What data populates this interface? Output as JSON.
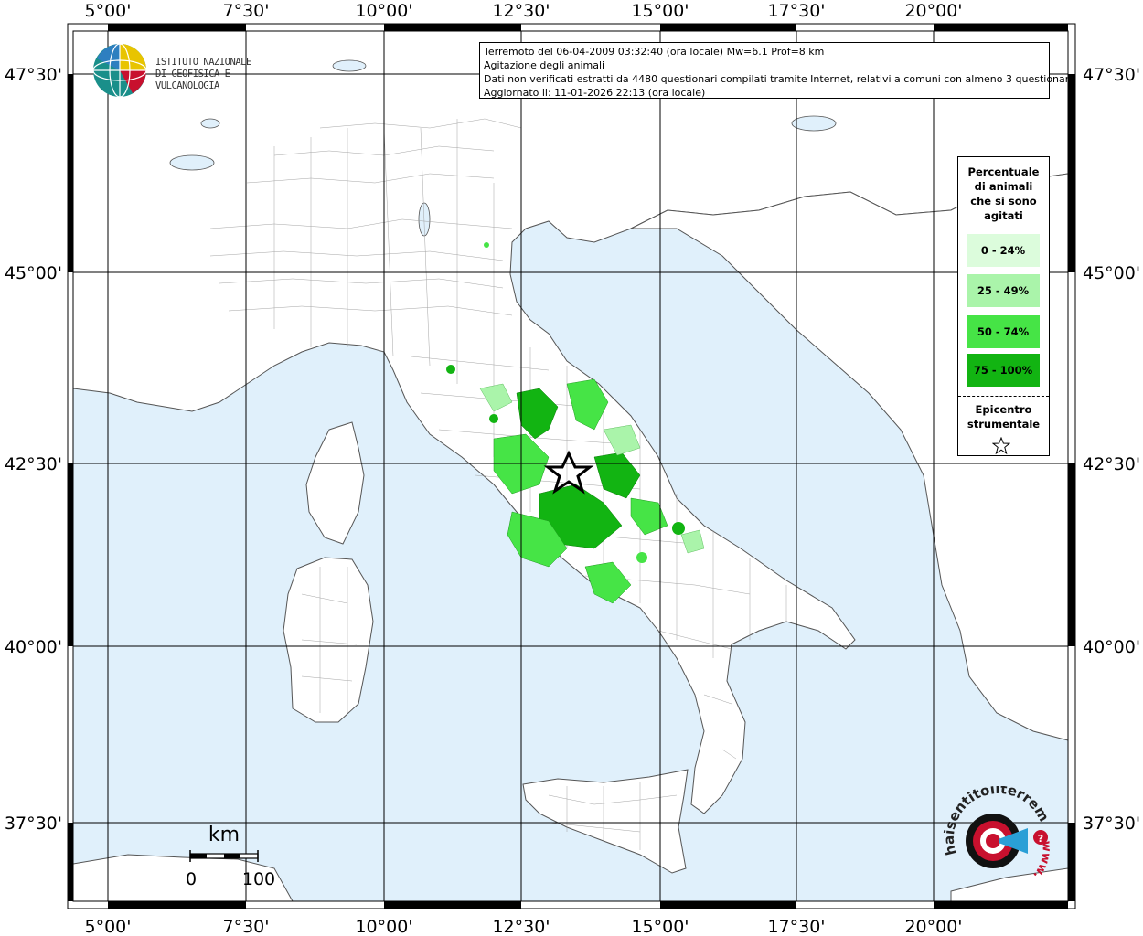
{
  "info": {
    "line1": "Terremoto del 06-04-2009 03:32:40 (ora locale) Mw=6.1 Prof=8 km",
    "line2": "Agitazione degli animali",
    "line3": "Dati non verificati estratti da 4480 questionari compilati tramite Internet, relativi a comuni con almeno 3 questionari.",
    "line4": "Aggiornato il: 11-01-2026 22:13 (ora locale)"
  },
  "logo": {
    "line1": "ISTITUTO NAZIONALE",
    "line2": "DI GEOFISICA E VULCANOLOGIA"
  },
  "axes": {
    "lon_labels": [
      "5°00'",
      "7°30'",
      "10°00'",
      "12°30'",
      "15°00'",
      "17°30'",
      "20°00'"
    ],
    "lat_labels": [
      "47°30'",
      "45°00'",
      "42°30'",
      "40°00'",
      "37°30'"
    ]
  },
  "legend": {
    "title_lines": [
      "Percentuale",
      "di animali",
      "che si sono",
      "agitati"
    ],
    "classes": [
      {
        "label": "0 - 24%",
        "color": "#dcfcdc"
      },
      {
        "label": "25 - 49%",
        "color": "#aaf4aa"
      },
      {
        "label": "50 - 74%",
        "color": "#46e446"
      },
      {
        "label": "75 - 100%",
        "color": "#12b412"
      }
    ],
    "epicenter_lines": [
      "Epicentro",
      "strumentale"
    ]
  },
  "scale": {
    "unit": "km",
    "start": "0",
    "end": "100"
  },
  "brand": {
    "text": "haisentitoilterremoto.it",
    "url_text": "www."
  },
  "colors": {
    "sea": "#e0f0fb",
    "land": "#ffffff",
    "border": "#777777"
  }
}
